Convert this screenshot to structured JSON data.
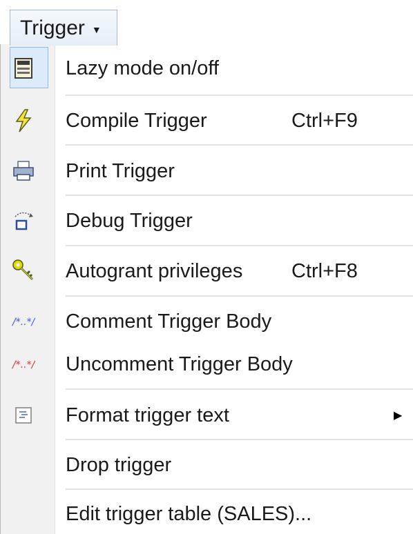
{
  "menu": {
    "title": "Trigger",
    "caret_icon": "caret-down-icon"
  },
  "items": [
    {
      "label": "Lazy mode on/off",
      "shortcut": "",
      "icon": "lazy-mode-icon"
    },
    {
      "label": "Compile Trigger",
      "shortcut": "Ctrl+F9",
      "icon": "lightning-icon"
    },
    {
      "label": "Print Trigger",
      "shortcut": "",
      "icon": "printer-icon"
    },
    {
      "label": "Debug Trigger",
      "shortcut": "",
      "icon": "debug-icon"
    },
    {
      "label": "Autogrant privileges",
      "shortcut": "Ctrl+F8",
      "icon": "keys-icon"
    },
    {
      "label": "Comment Trigger Body",
      "shortcut": "",
      "icon": "comment-icon"
    },
    {
      "label": "Uncomment Trigger Body",
      "shortcut": "",
      "icon": "uncomment-icon"
    },
    {
      "label": "Format trigger text",
      "shortcut": "",
      "icon": "format-icon",
      "submenu": true
    },
    {
      "label": "Drop trigger",
      "shortcut": "",
      "icon": ""
    },
    {
      "label": "Edit trigger table (SALES)...",
      "shortcut": "",
      "icon": ""
    }
  ],
  "colors": {
    "highlight": "#dcebfa",
    "comment_icon": "#3a5bd9",
    "uncomment_icon": "#e0323a",
    "lightning": "#e8d000"
  }
}
